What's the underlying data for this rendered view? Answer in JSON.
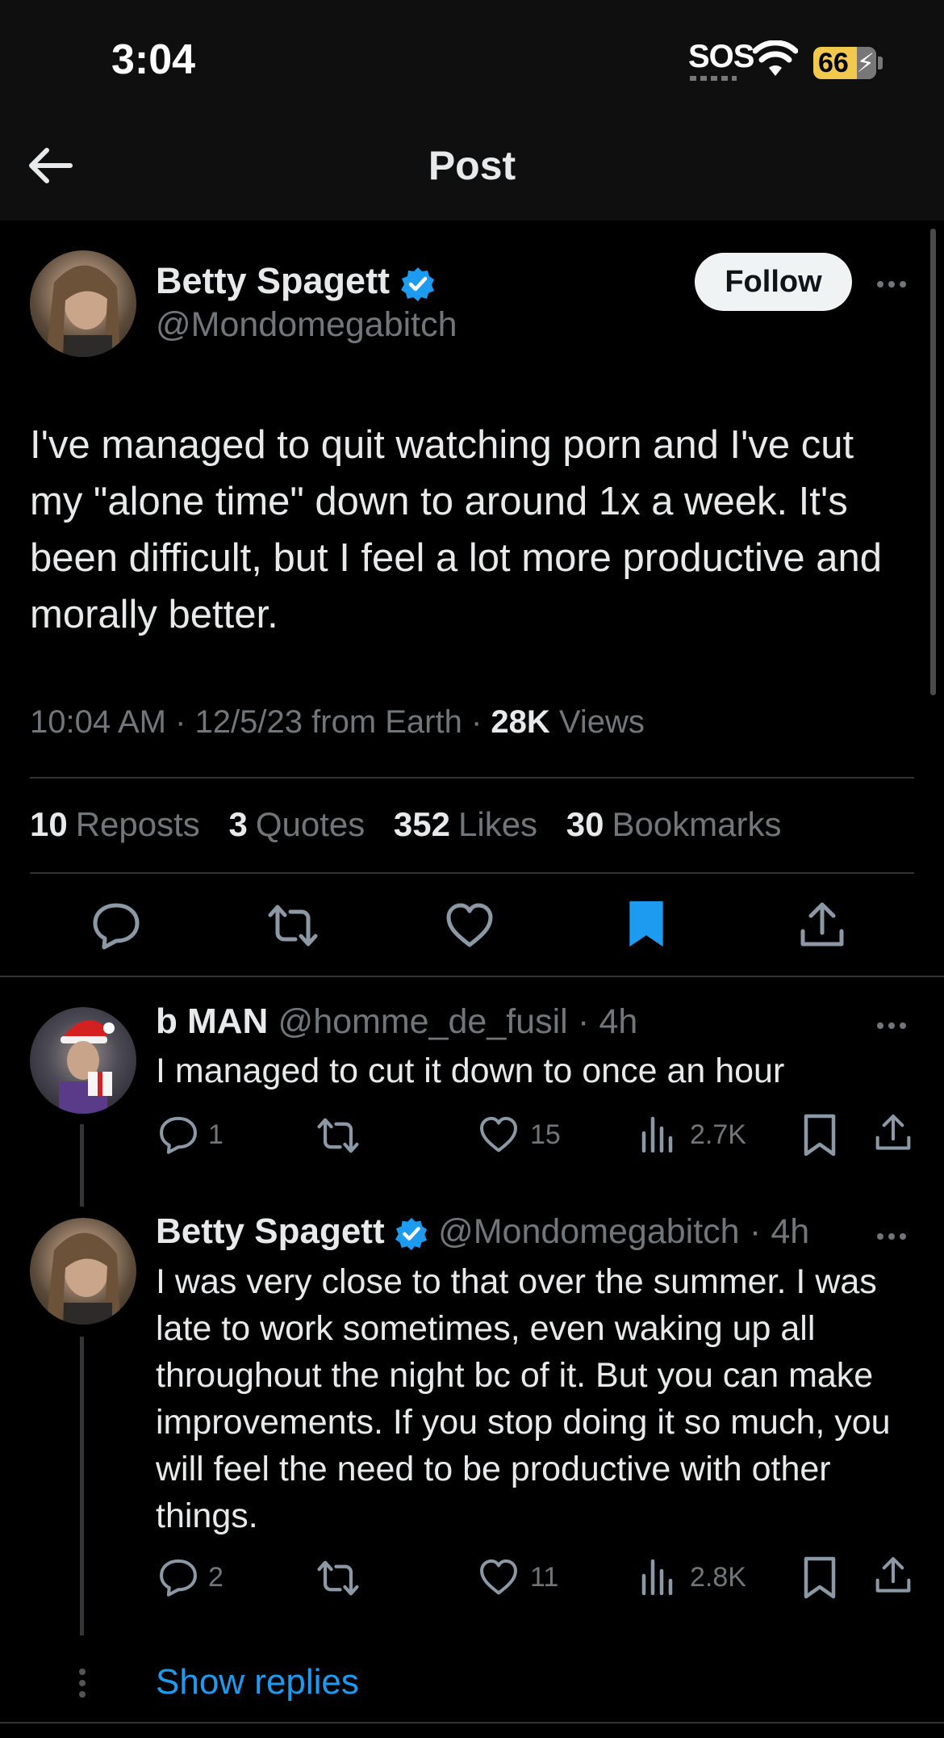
{
  "status_bar": {
    "time": "3:04",
    "sos": "SOS",
    "battery": "66"
  },
  "header": {
    "title": "Post"
  },
  "post": {
    "author_name": "Betty Spagett",
    "handle": "@Mondomegabitch",
    "follow_label": "Follow",
    "text": "I've managed to quit watching porn and I've cut my \"alone time\" down to around 1x a week. It's been difficult, but I feel a lot more productive and morally better.",
    "time": "10:04 AM",
    "date_source": "12/5/23 from Earth",
    "views_count": "28K",
    "views_label": "Views",
    "reposts_count": "10",
    "reposts_label": "Reposts",
    "quotes_count": "3",
    "quotes_label": "Quotes",
    "likes_count": "352",
    "likes_label": "Likes",
    "bookmarks_count": "30",
    "bookmarks_label": "Bookmarks"
  },
  "replies": [
    {
      "name": "b MAN",
      "handle": "@homme_de_fusil",
      "age": "4h",
      "text": "I managed to cut it down to once an hour",
      "comments": "1",
      "likes": "15",
      "views": "2.7K"
    },
    {
      "name": "Betty Spagett",
      "handle": "@Mondomegabitch",
      "age": "4h",
      "text": "I was very close to that over the summer. I was late to work sometimes, even waking up all throughout the night bc of it. But you can make improvements. If you stop doing it so much, you will feel the need to be productive with other things.",
      "comments": "2",
      "likes": "11",
      "views": "2.8K"
    }
  ],
  "show_replies": "Show replies",
  "colors": {
    "accent": "#1d9bf0",
    "background": "#000000",
    "text": "#e7e9ea",
    "muted": "#71767b"
  }
}
